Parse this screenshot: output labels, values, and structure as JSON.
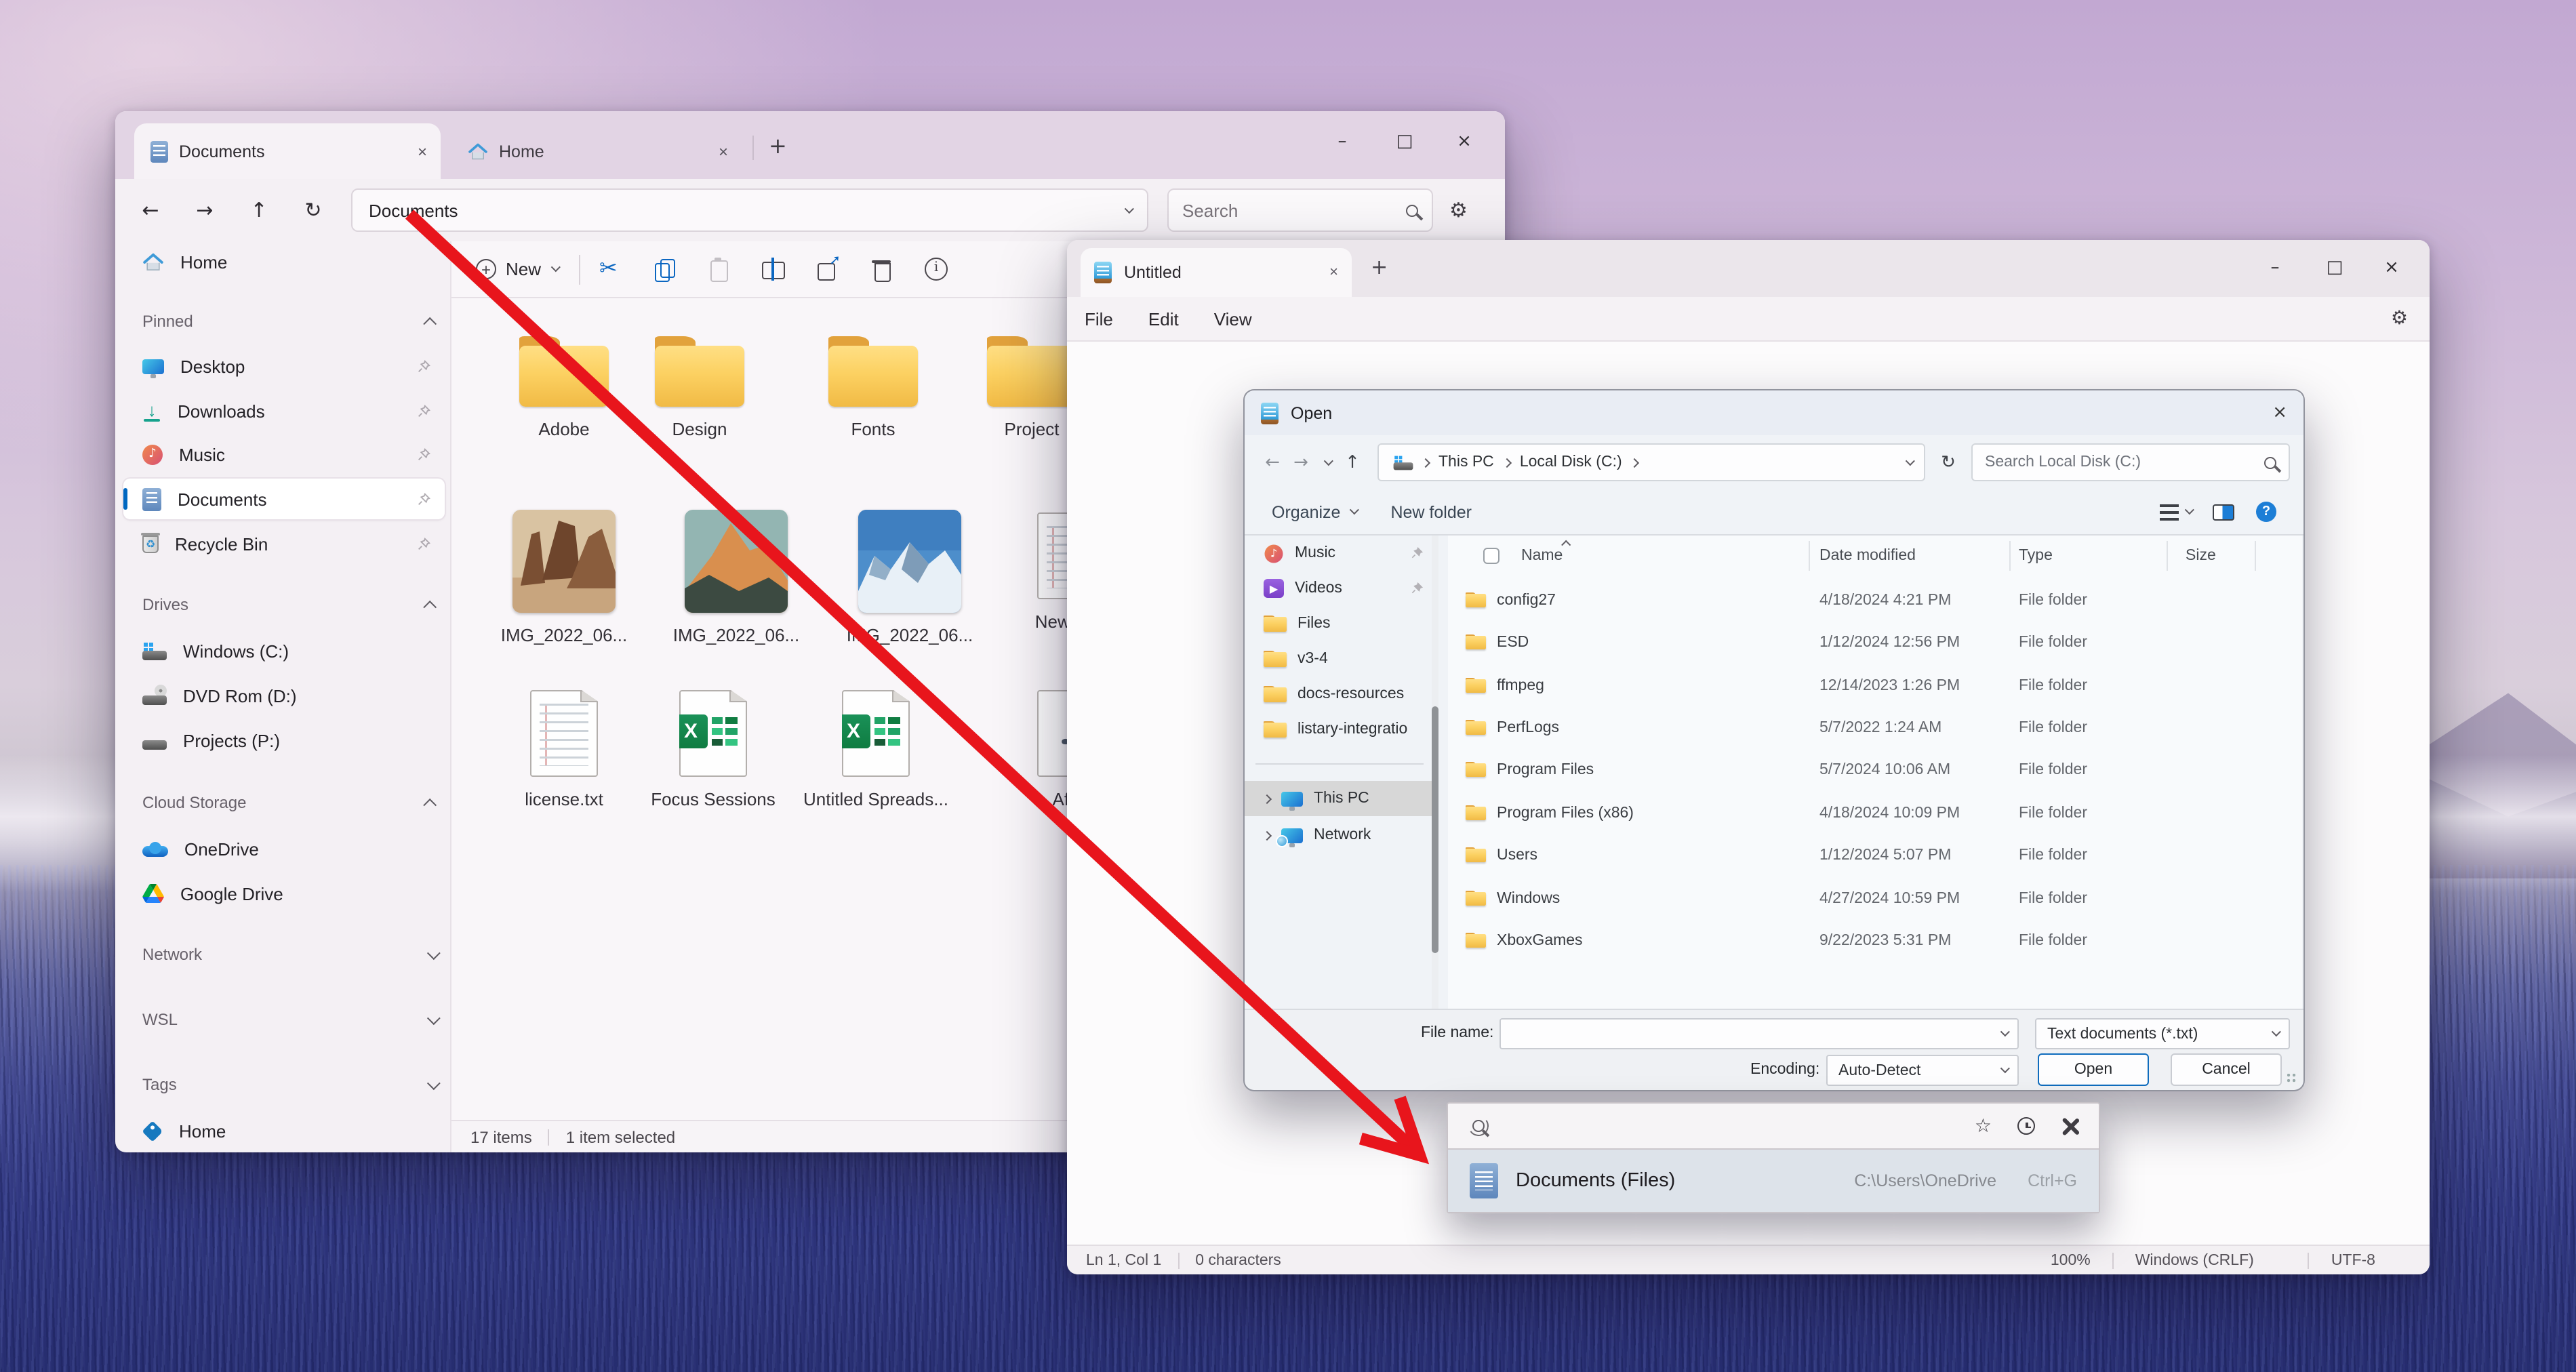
{
  "wallpaper": {
    "sky_top": "#c2a8d2",
    "field_bottom": "#2d3478",
    "accent": "#0067c0"
  },
  "arrow": {
    "color": "#e8151c"
  },
  "fe": {
    "tab_documents": "Documents",
    "tab_home": "Home",
    "glyph_close": "×",
    "glyph_min": "–",
    "glyph_max": "□",
    "glyph_new_tab": "+",
    "nav": {
      "back": "←",
      "forward": "→",
      "up": "↑",
      "refresh": "↻"
    },
    "address": "Documents",
    "search_placeholder": "Search",
    "new_button": "New",
    "sidebar": {
      "home": "Home",
      "header_pinned": "Pinned",
      "pinned": [
        {
          "label": "Desktop"
        },
        {
          "label": "Downloads"
        },
        {
          "label": "Music"
        },
        {
          "label": "Documents"
        },
        {
          "label": "Recycle Bin"
        }
      ],
      "header_drives": "Drives",
      "drives": [
        {
          "label": "Windows (C:)"
        },
        {
          "label": "DVD Rom (D:)"
        },
        {
          "label": "Projects (P:)"
        }
      ],
      "header_cloud": "Cloud Storage",
      "cloud": [
        {
          "label": "OneDrive"
        },
        {
          "label": "Google Drive"
        }
      ],
      "header_network": "Network",
      "header_wsl": "WSL",
      "header_tags": "Tags",
      "tag_home": "Home"
    },
    "grid": {
      "folders": [
        "Adobe",
        "Design",
        "Fonts",
        "Project"
      ],
      "images": [
        "IMG_2022_06...",
        "IMG_2022_06...",
        "IMG_2022_06..."
      ],
      "newtext": "New Text",
      "license": "license.txt",
      "focus": "Focus Sessions",
      "untitled": "Untitled Spreads...",
      "after": "After"
    },
    "status_items": "17 items",
    "status_selected": "1 item selected"
  },
  "notepad": {
    "tab": "Untitled",
    "glyph_close": "×",
    "glyph_min": "–",
    "glyph_max": "□",
    "glyph_new_tab": "+",
    "menu_file": "File",
    "menu_edit": "Edit",
    "menu_view": "View",
    "status_ln": "Ln 1, Col 1",
    "status_chars": "0 characters",
    "status_zoom": "100%",
    "status_eol": "Windows (CRLF)",
    "status_enc": "UTF-8"
  },
  "dlg": {
    "title": "Open",
    "glyph_close": "×",
    "nav": {
      "back": "←",
      "forward": "→",
      "up": "↑",
      "refresh": "↻"
    },
    "crumb_pc": "This PC",
    "crumb_disk": "Local Disk (C:)",
    "search_placeholder": "Search Local Disk (C:)",
    "organize": "Organize",
    "new_folder": "New folder",
    "side_music": "Music",
    "side_videos": "Videos",
    "side_files": "Files",
    "side_v34": "v3-4",
    "side_docs": "docs-resources",
    "side_listary": "listary-integratio",
    "side_thispc": "This PC",
    "side_network": "Network",
    "col_name": "Name",
    "col_date": "Date modified",
    "col_type": "Type",
    "col_size": "Size",
    "rows": [
      {
        "name": "config27",
        "date": "4/18/2024 4:21 PM",
        "type": "File folder"
      },
      {
        "name": "ESD",
        "date": "1/12/2024 12:56 PM",
        "type": "File folder"
      },
      {
        "name": "ffmpeg",
        "date": "12/14/2023 1:26 PM",
        "type": "File folder"
      },
      {
        "name": "PerfLogs",
        "date": "5/7/2022 1:24 AM",
        "type": "File folder"
      },
      {
        "name": "Program Files",
        "date": "5/7/2024 10:06 AM",
        "type": "File folder"
      },
      {
        "name": "Program Files (x86)",
        "date": "4/18/2024 10:09 PM",
        "type": "File folder"
      },
      {
        "name": "Users",
        "date": "1/12/2024 5:07 PM",
        "type": "File folder"
      },
      {
        "name": "Windows",
        "date": "4/27/2024 10:59 PM",
        "type": "File folder"
      },
      {
        "name": "XboxGames",
        "date": "9/22/2023 5:31 PM",
        "type": "File folder"
      }
    ],
    "file_name_label": "File name:",
    "file_type": "Text documents (*.txt)",
    "encoding_label": "Encoding:",
    "encoding": "Auto-Detect",
    "open": "Open",
    "cancel": "Cancel"
  },
  "palette": {
    "result": "Documents (Files)",
    "path": "C:\\Users\\OneDrive",
    "shortcut": "Ctrl+G"
  }
}
